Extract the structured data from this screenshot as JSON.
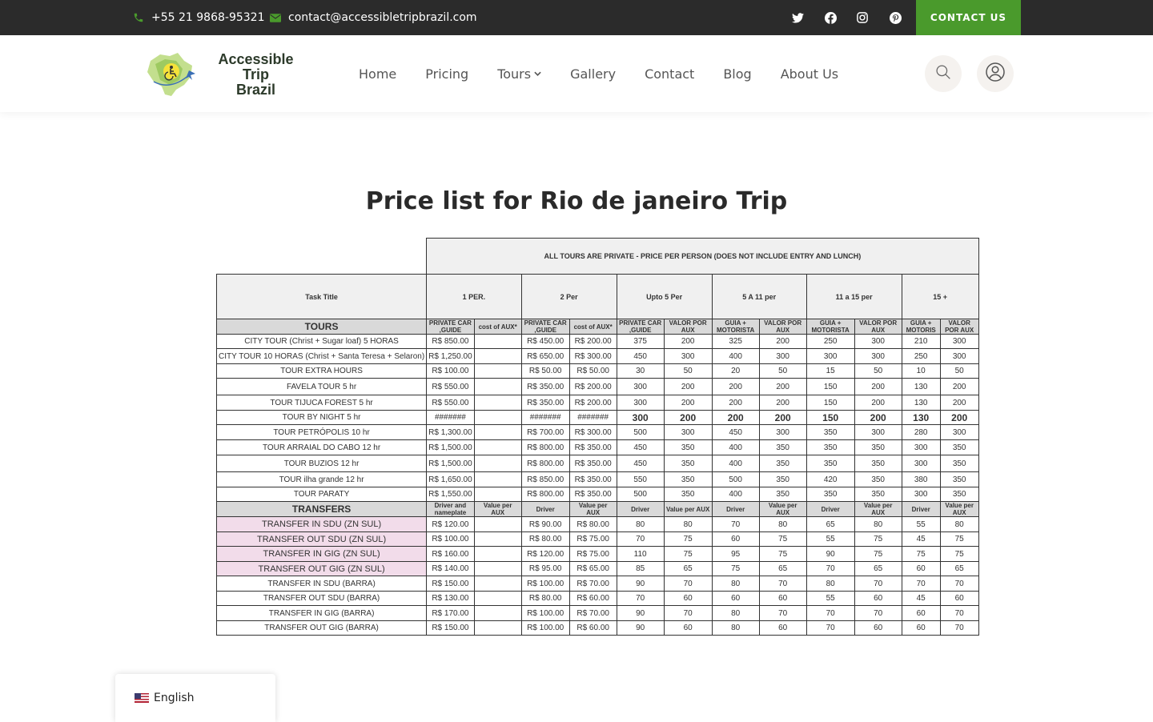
{
  "topbar": {
    "phone": "+55 21 9868-95321",
    "email": "contact@accessibletripbrazil.com",
    "social": [
      "twitter-icon",
      "facebook-icon",
      "instagram-icon",
      "pinterest-icon"
    ],
    "contact_label": "CONTACT US"
  },
  "brand": {
    "line1": "Accessible Trip",
    "line2": "Brazil"
  },
  "nav": {
    "home": "Home",
    "pricing": "Pricing",
    "tours": "Tours",
    "gallery": "Gallery",
    "contact": "Contact",
    "blog": "Blog",
    "about": "About Us"
  },
  "colors": {
    "topbar_bg": "#2b2b2b",
    "accent": "#4a9a2c",
    "transfer_pink": "#f2dcea",
    "header_gray": "#d9d9d9"
  },
  "page_title": "Price list for Rio de janeiro Trip",
  "table": {
    "main_header": "ALL TOURS ARE PRIVATE - PRICE PER PERSON (DOES NOT INCLUDE ENTRY AND LUNCH)",
    "task_title": "Task Title",
    "groups": [
      "1 PER.",
      "2 Per",
      "Upto 5 Per",
      "5 A 11 per",
      "11 a 15 per",
      "15 +"
    ],
    "tours_title": "TOURS",
    "tours_subheaders": [
      "PRIVATE CAR ,GUIDE",
      "cost of AUX*",
      "PRIVATE CAR ,GUIDE",
      "cost of AUX*",
      "PRIVATE CAR ,GUIDE",
      "VALOR POR AUX",
      "GUIA + MOTORISTA",
      "VALOR POR AUX",
      "GUIA + MOTORISTA",
      "VALOR POR AUX",
      "GUIA + MOTORIS",
      "VALOR POR AUX"
    ],
    "tours": [
      {
        "title": "CITY TOUR  (Christ + Sugar loaf) 5 HORAS",
        "v": [
          "R$ 850.00",
          "",
          "R$ 450.00",
          "R$ 200.00",
          "375",
          "200",
          "325",
          "200",
          "250",
          "300",
          "210",
          "300"
        ]
      },
      {
        "title": "CITY TOUR 10 HORAS (Christ + Santa Teresa + Selaron)",
        "v": [
          "R$ 1,250.00",
          "",
          "R$ 650.00",
          "R$ 300.00",
          "450",
          "300",
          "400",
          "300",
          "300",
          "300",
          "250",
          "300"
        ]
      },
      {
        "title": "TOUR EXTRA HOURS",
        "v": [
          "R$ 100.00",
          "",
          "R$ 50.00",
          "R$ 50.00",
          "30",
          "50",
          "20",
          "50",
          "15",
          "50",
          "10",
          "50"
        ]
      },
      {
        "title": "FAVELA TOUR 5 hr",
        "v": [
          "R$ 550.00",
          "",
          "R$ 350.00",
          "R$ 200.00",
          "300",
          "200",
          "200",
          "200",
          "150",
          "200",
          "130",
          "200"
        ]
      },
      {
        "title": "TOUR  TIJUCA FOREST 5 hr",
        "v": [
          "R$ 550.00",
          "",
          "R$ 350.00",
          "R$ 200.00",
          "300",
          "200",
          "200",
          "200",
          "150",
          "200",
          "130",
          "200"
        ]
      },
      {
        "title": "TOUR BY NIGHT 5 hr",
        "v": [
          "#######",
          "",
          "#######",
          "#######",
          "300",
          "200",
          "200",
          "200",
          "150",
          "200",
          "130",
          "200"
        ]
      },
      {
        "title": "TOUR PETRÓPOLIS 10 hr",
        "v": [
          "R$ 1,300.00",
          "",
          "R$ 700.00",
          "R$ 300.00",
          "500",
          "300",
          "450",
          "300",
          "350",
          "300",
          "280",
          "300"
        ]
      },
      {
        "title": "TOUR ARRAIAL DO CABO 12 hr",
        "v": [
          "R$ 1,500.00",
          "",
          "R$ 800.00",
          "R$ 350.00",
          "450",
          "350",
          "400",
          "350",
          "350",
          "350",
          "300",
          "350"
        ]
      },
      {
        "title": "TOUR BUZIOS 12 hr",
        "v": [
          "R$ 1,500.00",
          "",
          "R$ 800.00",
          "R$ 350.00",
          "450",
          "350",
          "400",
          "350",
          "350",
          "350",
          "300",
          "350"
        ]
      },
      {
        "title": "TOUR ilha grande 12 hr",
        "v": [
          "R$ 1,650.00",
          "",
          "R$ 850.00",
          "R$ 350.00",
          "550",
          "350",
          "500",
          "350",
          "420",
          "350",
          "380",
          "350"
        ]
      },
      {
        "title": "TOUR PARATY",
        "v": [
          "R$ 1,550.00",
          "",
          "R$ 800.00",
          "R$ 350.00",
          "500",
          "350",
          "400",
          "350",
          "350",
          "350",
          "300",
          "350"
        ]
      }
    ],
    "transfers_title": "TRANSFERS",
    "transfers_subheaders": [
      "Driver and nameplate",
      "Value per AUX",
      "Driver",
      "Value per AUX",
      "Driver",
      "Value per AUX",
      "Driver",
      "Value per AUX",
      "Driver",
      "Value per AUX",
      "Driver",
      "Value per AUX"
    ],
    "transfers": [
      {
        "title": "TRANSFER IN SDU (ZN SUL)",
        "v": [
          "R$ 120.00",
          "",
          "R$ 90.00",
          "R$ 80.00",
          "80",
          "80",
          "70",
          "80",
          "65",
          "80",
          "55",
          "80"
        ]
      },
      {
        "title": "TRANSFER OUT SDU (ZN SUL)",
        "v": [
          "R$ 100.00",
          "",
          "R$ 80.00",
          "R$ 75.00",
          "70",
          "75",
          "60",
          "75",
          "55",
          "75",
          "45",
          "75"
        ]
      },
      {
        "title": "TRANSFER IN GIG (ZN SUL)",
        "v": [
          "R$ 160.00",
          "",
          "R$ 120.00",
          "R$ 75.00",
          "110",
          "75",
          "95",
          "75",
          "90",
          "75",
          "75",
          "75"
        ]
      },
      {
        "title": "TRANSFER OUT GIG (ZN SUL)",
        "v": [
          "R$ 140.00",
          "",
          "R$ 95.00",
          "R$ 65.00",
          "85",
          "65",
          "75",
          "65",
          "70",
          "65",
          "60",
          "65"
        ]
      },
      {
        "title": "TRANSFER IN SDU (BARRA)",
        "v": [
          "R$ 150.00",
          "",
          "R$ 100.00",
          "R$ 70.00",
          "90",
          "70",
          "80",
          "70",
          "80",
          "70",
          "70",
          "70"
        ]
      },
      {
        "title": "TRANSFER OUT SDU  (BARRA)",
        "v": [
          "R$ 130.00",
          "",
          "R$ 80.00",
          "R$ 60.00",
          "70",
          "60",
          "60",
          "60",
          "55",
          "60",
          "45",
          "60"
        ]
      },
      {
        "title": "TRANSFER IN GIG  (BARRA)",
        "v": [
          "R$ 170.00",
          "",
          "R$ 100.00",
          "R$ 70.00",
          "90",
          "70",
          "80",
          "70",
          "70",
          "70",
          "60",
          "70"
        ]
      },
      {
        "title": "TRANSFER OUT GIG (BARRA)",
        "v": [
          "R$ 150.00",
          "",
          "R$ 100.00",
          "R$ 60.00",
          "90",
          "60",
          "80",
          "60",
          "70",
          "60",
          "60",
          "70"
        ]
      }
    ]
  },
  "language": {
    "label": "English"
  }
}
